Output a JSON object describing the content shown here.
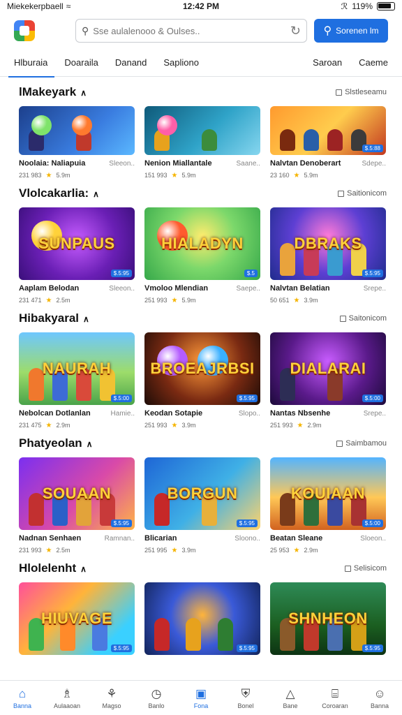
{
  "status_bar": {
    "carrier": "Miekekerpbaell",
    "time": "12:42 PM",
    "battery": "119%"
  },
  "header": {
    "search_placeholder": "Sse aulalenooo & Oulses..",
    "search_button": "Sorenen lm"
  },
  "tabs": [
    {
      "label": "Hlburaia",
      "active": true
    },
    {
      "label": "Doaraila",
      "active": false
    },
    {
      "label": "Danand",
      "active": false
    },
    {
      "label": "Sapliono",
      "active": false
    },
    {
      "label": "Saroan",
      "active": false
    },
    {
      "label": "Caeme",
      "active": false
    }
  ],
  "sections": [
    {
      "title": "lMakeyark",
      "see_all": "Slstleseamu",
      "thumb_size": "small",
      "cards": [
        {
          "title": "Noolaia: Naliapuia",
          "category": "Sleeon..",
          "installs": "231 983",
          "rating": "5.9m",
          "art": "orbs-blue",
          "word": "",
          "badge": ""
        },
        {
          "title": "Nenion Miallantale",
          "category": "Saane..",
          "installs": "151 993",
          "rating": "5.9m",
          "art": "crystal-teal",
          "word": "",
          "badge": ""
        },
        {
          "title": "Nalvtan Denoberart",
          "category": "Sdepe..",
          "installs": "23 160",
          "rating": "5.9m",
          "art": "heroes-orange",
          "word": "",
          "badge": "$.5:88"
        }
      ]
    },
    {
      "title": "Vlolcakarlia:",
      "see_all": "Saitionicom",
      "thumb_size": "big",
      "cards": [
        {
          "title": "Aaplam Belodan",
          "category": "Sleeon..",
          "installs": "231 471",
          "rating": "2.5m",
          "art": "purple-burst",
          "word": "SUNPAUS",
          "badge": "$.5:95"
        },
        {
          "title": "Vmoloo Mlendian",
          "category": "Saepe..",
          "installs": "251 993",
          "rating": "5.9m",
          "art": "green-sun",
          "word": "HIALADYN",
          "badge": "$.5"
        },
        {
          "title": "Nalvtan Belatian",
          "category": "Srepe..",
          "installs": "50 651",
          "rating": "3.9m",
          "art": "blue-party",
          "word": "DBRAKS",
          "badge": "$.5:95"
        }
      ]
    },
    {
      "title": "Hibakyaral",
      "see_all": "Saitonicom",
      "thumb_size": "big",
      "cards": [
        {
          "title": "Nebolcan Dotlanlan",
          "category": "Hamie..",
          "installs": "231 475",
          "rating": "2.9m",
          "art": "green-village",
          "word": "NAURAH",
          "badge": "$.5:00"
        },
        {
          "title": "Keodan Sotapie",
          "category": "Slopo..",
          "installs": "251 993",
          "rating": "3.9m",
          "art": "dark-bear",
          "word": "BROEAJRBSI",
          "badge": "$.5:95"
        },
        {
          "title": "Nantas Nbsenhe",
          "category": "Srepe..",
          "installs": "251 993",
          "rating": "2.9m",
          "art": "violet-monster",
          "word": "DIALARAI",
          "badge": "$.5:00"
        }
      ]
    },
    {
      "title": "Phatyeolan",
      "see_all": "Saimbamou",
      "thumb_size": "big",
      "cards": [
        {
          "title": "Nadnan Senhaen",
          "category": "Ramnan..",
          "installs": "231 993",
          "rating": "2.5m",
          "art": "purple-squad",
          "word": "SOUAAN",
          "badge": "$.5:95"
        },
        {
          "title": "Blicarian",
          "category": "Sloono..",
          "installs": "251 995",
          "rating": "3.9m",
          "art": "blue-hero",
          "word": "BORGUN",
          "badge": "$.5:95"
        },
        {
          "title": "Beatan Sleane",
          "category": "Sloeon..",
          "installs": "25 953",
          "rating": "2.9m",
          "art": "sky-town",
          "word": "KOUIAAN",
          "badge": "$.5:00"
        }
      ]
    },
    {
      "title": "Hlolelenht",
      "see_all": "Selisicom",
      "thumb_size": "big",
      "cards": [
        {
          "title": "",
          "category": "",
          "installs": "",
          "rating": "",
          "art": "rainbow-pals",
          "word": "HIUVAGE",
          "badge": "$.5:95"
        },
        {
          "title": "",
          "category": "",
          "installs": "",
          "rating": "",
          "art": "navy-hero",
          "word": "",
          "badge": "$.5:95"
        },
        {
          "title": "",
          "category": "",
          "installs": "",
          "rating": "",
          "art": "forest-band",
          "word": "SHNHEON",
          "badge": "$.5:95"
        }
      ]
    }
  ],
  "bottom_nav": [
    {
      "label": "Banna",
      "icon": "home-icon",
      "active": true
    },
    {
      "label": "Aulaaoan",
      "icon": "bell-icon",
      "active": false
    },
    {
      "label": "Magso",
      "icon": "games-icon",
      "active": false
    },
    {
      "label": "Banlo",
      "icon": "compass-icon",
      "active": false
    },
    {
      "label": "Fona",
      "icon": "apps-icon",
      "active": true
    },
    {
      "label": "Bonel",
      "icon": "shield-icon",
      "active": false
    },
    {
      "label": "Bane",
      "icon": "alert-icon",
      "active": false
    },
    {
      "label": "Coroaran",
      "icon": "cart-icon",
      "active": false
    },
    {
      "label": "Banna",
      "icon": "account-icon",
      "active": false
    }
  ]
}
